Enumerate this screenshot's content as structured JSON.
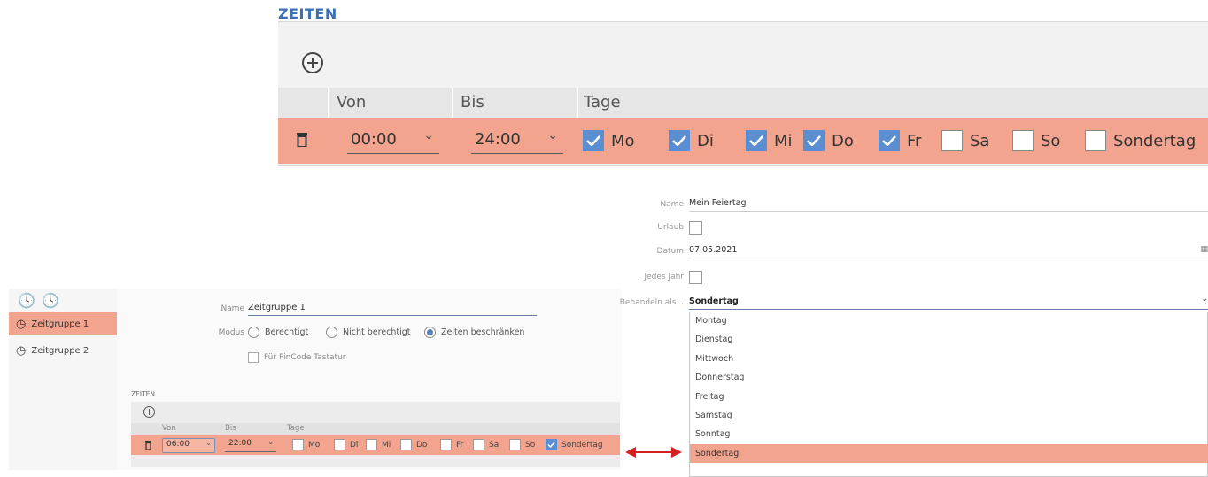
{
  "top_panel": {
    "section_title": "ZEITEN",
    "headers": {
      "from": "Von",
      "to": "Bis",
      "days": "Tage"
    },
    "row": {
      "from": "00:00",
      "to": "24:00",
      "days": [
        {
          "label": "Mo",
          "checked": true
        },
        {
          "label": "Di",
          "checked": true
        },
        {
          "label": "Mi",
          "checked": true
        },
        {
          "label": "Do",
          "checked": true
        },
        {
          "label": "Fr",
          "checked": true
        },
        {
          "label": "Sa",
          "checked": false
        },
        {
          "label": "So",
          "checked": false
        },
        {
          "label": "Sondertag",
          "checked": false
        }
      ]
    }
  },
  "small_app": {
    "sidebar": {
      "items": [
        {
          "label": "Zeitgruppe 1",
          "selected": true
        },
        {
          "label": "Zeitgruppe 2",
          "selected": false
        }
      ]
    },
    "form": {
      "name_label": "Name",
      "name_value": "Zeitgruppe 1",
      "mode_label": "Modus",
      "modes": [
        {
          "label": "Berechtigt",
          "selected": false
        },
        {
          "label": "Nicht berechtigt",
          "selected": false
        },
        {
          "label": "Zeiten beschränken",
          "selected": true
        }
      ],
      "pincode_label": "Für PinCode Tastatur"
    },
    "times": {
      "section_title": "ZEITEN",
      "headers": {
        "from": "Von",
        "to": "Bis",
        "days": "Tage"
      },
      "row": {
        "from": "06:00",
        "to": "22:00",
        "days": [
          {
            "label": "Mo",
            "checked": false
          },
          {
            "label": "Di",
            "checked": false
          },
          {
            "label": "Mi",
            "checked": false
          },
          {
            "label": "Do",
            "checked": false
          },
          {
            "label": "Fr",
            "checked": false
          },
          {
            "label": "Sa",
            "checked": false
          },
          {
            "label": "So",
            "checked": false
          },
          {
            "label": "Sondertag",
            "checked": true
          }
        ]
      }
    }
  },
  "holiday_form": {
    "name_label": "Name",
    "name_value": "Mein Feiertag",
    "vacation_label": "Urlaub",
    "date_label": "Datum",
    "date_value": "07.05.2021",
    "every_year_label": "Jedes Jahr",
    "treat_as_label": "Behandeln als...",
    "treat_as_value": "Sondertag",
    "options": [
      "Montag",
      "Dienstag",
      "Mittwoch",
      "Donnerstag",
      "Freitag",
      "Samstag",
      "Sonntag",
      "Sondertag"
    ],
    "selected_option": "Sondertag"
  },
  "colors": {
    "accent": "#f2a48e",
    "check": "#5b8dd1",
    "arrow": "#d42020",
    "title_blue": "#3b6fb6"
  }
}
